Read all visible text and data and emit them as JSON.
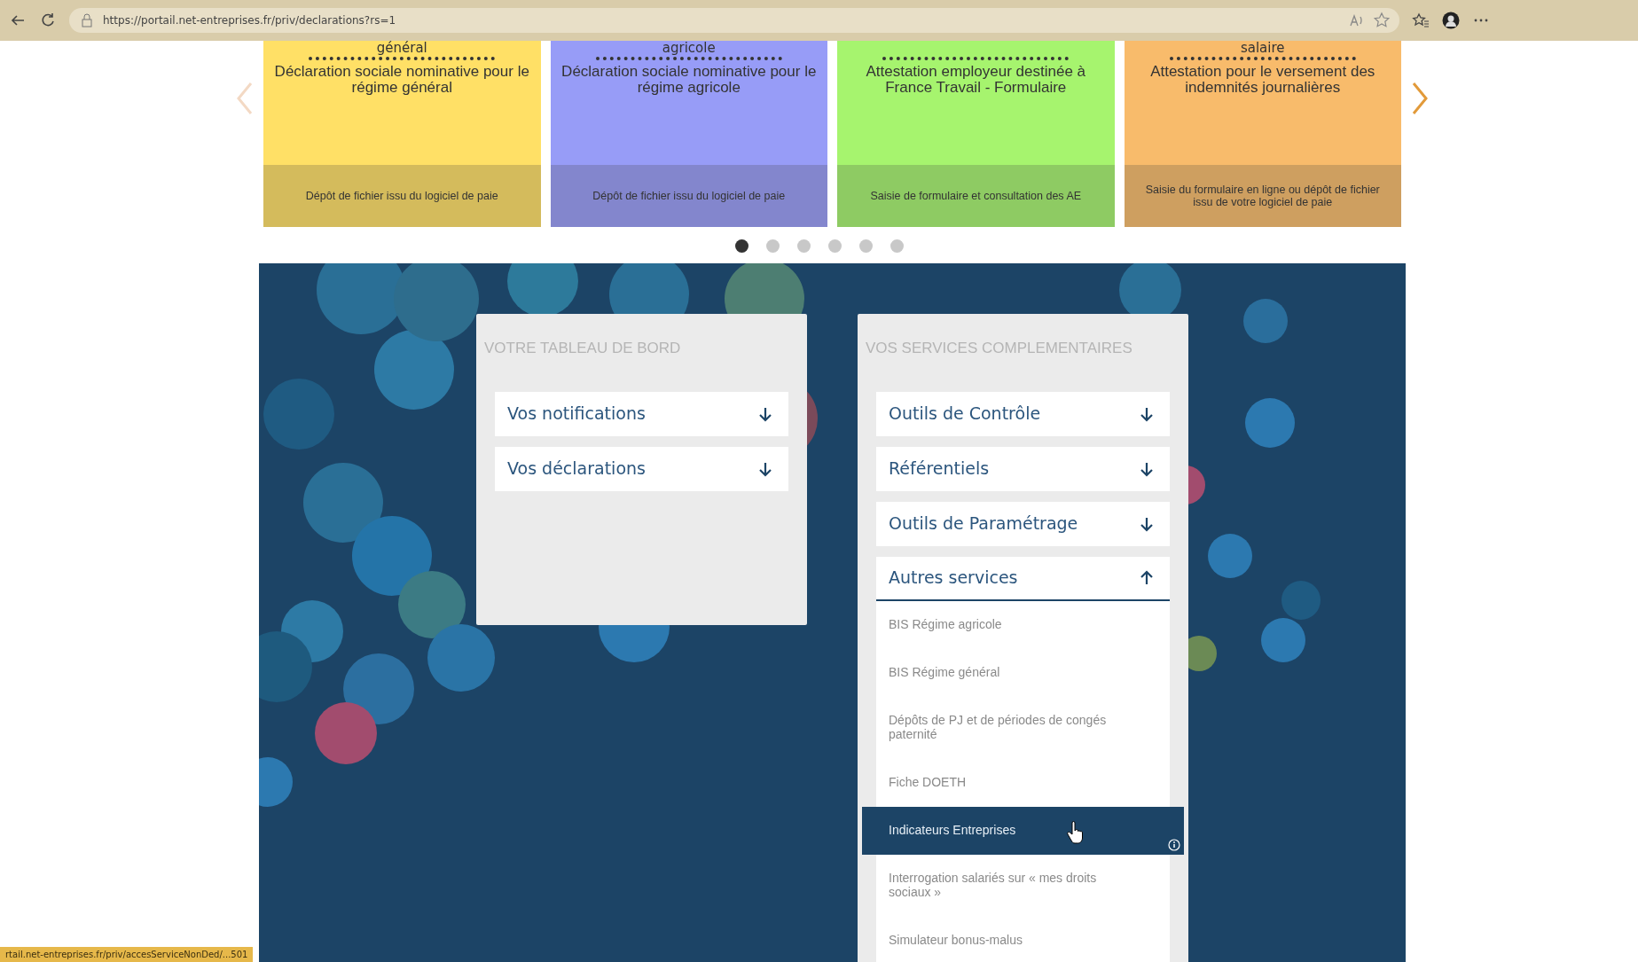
{
  "browser": {
    "url": "https://portail.net-entreprises.fr/priv/declarations?rs=1",
    "status_link": "rtail.net-entreprises.fr/priv/accesServiceNonDed/...501"
  },
  "carousel": {
    "cards": [
      {
        "title": "général",
        "description": "Déclaration sociale nominative pour le régime général",
        "footer": "Dépôt de fichier issu du logiciel de paie",
        "color": "#ffe066"
      },
      {
        "title": "agricole",
        "description": "Déclaration sociale nominative pour le régime agricole",
        "footer": "Dépôt de fichier issu du logiciel de paie",
        "color": "#979cf7"
      },
      {
        "description": "Attestation employeur destinée à France Travail - Formulaire",
        "footer": "Saisie de formulaire et consultation des AE",
        "color": "#a6f46e"
      },
      {
        "title": "salaire",
        "description": "Attestation pour le versement des indemnités journalières",
        "footer": "Saisie du formulaire en ligne ou dépôt de fichier issu de votre logiciel de paie",
        "color": "#f8bb6b"
      }
    ],
    "dots": [
      {
        "selected": true
      },
      {
        "selected": false
      },
      {
        "selected": false
      },
      {
        "selected": false
      },
      {
        "selected": false
      },
      {
        "selected": false
      }
    ]
  },
  "dashboard": {
    "title": "VOTRE TABLEAU DE BORD",
    "items": [
      {
        "label": "Vos notifications",
        "expanded": false
      },
      {
        "label": "Vos déclarations",
        "expanded": false
      }
    ]
  },
  "services": {
    "title": "VOS SERVICES COMPLEMENTAIRES",
    "items": [
      {
        "label": "Outils de Contrôle",
        "expanded": false
      },
      {
        "label": "Référentiels",
        "expanded": false
      },
      {
        "label": "Outils de Paramétrage",
        "expanded": false
      },
      {
        "label": "Autres services",
        "expanded": true,
        "children": [
          {
            "label": "BIS Régime agricole",
            "selected": false
          },
          {
            "label": "BIS Régime général",
            "selected": false
          },
          {
            "label": "Dépôts de PJ et de périodes de congés paternité",
            "selected": false
          },
          {
            "label": "Fiche DOETH",
            "selected": false
          },
          {
            "label": "Indicateurs Entreprises",
            "selected": true
          },
          {
            "label": "Interrogation salariés sur « mes droits sociaux »",
            "selected": false
          },
          {
            "label": "Simulateur bonus-malus",
            "selected": false
          }
        ]
      }
    ]
  }
}
